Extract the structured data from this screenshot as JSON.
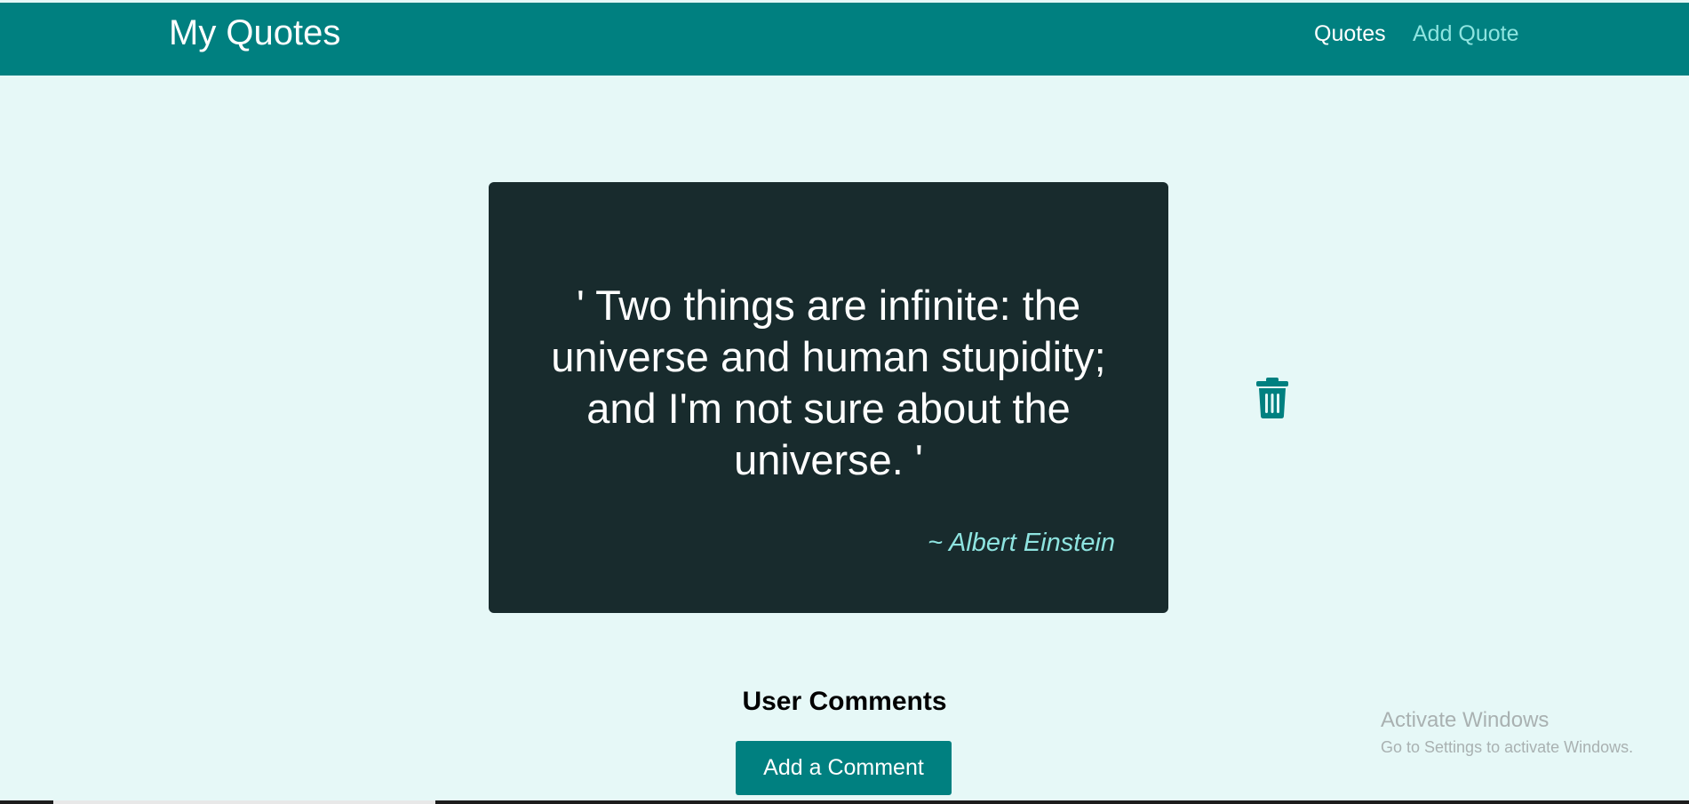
{
  "navbar": {
    "brand": "My Quotes",
    "links": [
      "Quotes",
      "Add Quote"
    ],
    "background": "#008080",
    "active_link_color": "#ffffff",
    "link_color": "#8ee4e0"
  },
  "quote": {
    "text": "' Two things are infinite: the universe and human stupidity; and I'm not sure about the universe. '",
    "author": "~ Albert Einstein",
    "card_color": "#182b2d",
    "delete_icon": "trash-icon"
  },
  "comments": {
    "heading": "User Comments",
    "add_button": "Add a Comment"
  },
  "watermark": {
    "title": "Activate Windows",
    "subtitle": "Go to Settings to activate Windows."
  }
}
